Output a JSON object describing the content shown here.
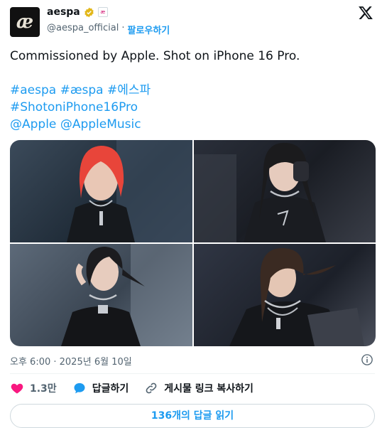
{
  "author": {
    "name": "aespa",
    "handle": "@aespa_official",
    "separator": "·",
    "follow_label": "팔로우하기",
    "affiliate_badge": "æ"
  },
  "tweet": {
    "line1": "Commissioned by Apple. Shot on iPhone 16 Pro.",
    "hashtags": [
      "#aespa",
      "#æspa",
      "#에스파"
    ],
    "hashtag2": "#ShotoniPhone16Pro",
    "mentions": [
      "@Apple",
      "@AppleMusic"
    ]
  },
  "photos": [
    {
      "hair": "#e8453a"
    },
    {
      "hair": "#1b1b1d"
    },
    {
      "hair": "#1c1c1f"
    },
    {
      "hair": "#3a2a22"
    }
  ],
  "meta": {
    "timestamp": "오후 6:00 · 2025년 6월 10일"
  },
  "actions": {
    "likes": "1.3만",
    "reply_label": "답글하기",
    "copy_link_label": "게시물 링크 복사하기"
  },
  "read_replies_label": "136개의 답글 읽기",
  "colors": {
    "accent": "#1d9bf0",
    "like": "#f91880",
    "muted": "#536471"
  }
}
